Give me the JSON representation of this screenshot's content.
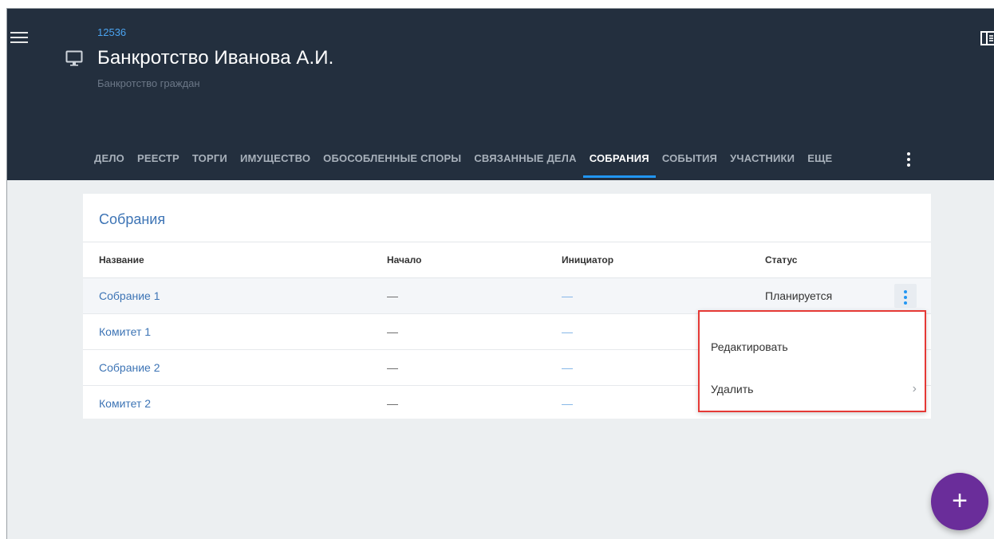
{
  "header": {
    "case_number": "12536",
    "title": "Банкротство Иванова А.И.",
    "subtitle": "Банкротство граждан"
  },
  "tabs": [
    {
      "label": "ДЕЛО"
    },
    {
      "label": "РЕЕСТР"
    },
    {
      "label": "ТОРГИ"
    },
    {
      "label": "ИМУЩЕСТВО"
    },
    {
      "label": "ОБОСОБЛЕННЫЕ СПОРЫ"
    },
    {
      "label": "СВЯЗАННЫЕ ДЕЛА"
    },
    {
      "label": "СОБРАНИЯ",
      "active": true
    },
    {
      "label": "СОБЫТИЯ"
    },
    {
      "label": "УЧАСТНИКИ"
    },
    {
      "label": "ЕЩЕ"
    }
  ],
  "card": {
    "title": "Собрания",
    "columns": [
      "Название",
      "Начало",
      "Инициатор",
      "Статус"
    ],
    "rows": [
      {
        "name": "Собрание 1",
        "start": "—",
        "initiator": "—",
        "status": "Планируется"
      },
      {
        "name": "Комитет 1",
        "start": "—",
        "initiator": "—",
        "status": ""
      },
      {
        "name": "Собрание 2",
        "start": "—",
        "initiator": "—",
        "status": ""
      },
      {
        "name": "Комитет 2",
        "start": "—",
        "initiator": "—",
        "status": ""
      }
    ]
  },
  "context_menu": {
    "edit": "Редактировать",
    "delete": "Удалить"
  },
  "fab": {
    "label": "+"
  },
  "icons": {
    "menu": "hamburger-icon",
    "case": "monitor-icon",
    "panel": "panel-toggle-icon",
    "more": "more-vert-icon",
    "chevron": "chevron-right-icon"
  },
  "colors": {
    "header_bg": "#232f3e",
    "accent": "#2196f3",
    "link": "#3d74b5",
    "fab": "#6a2d9a",
    "highlight": "#e53935"
  }
}
